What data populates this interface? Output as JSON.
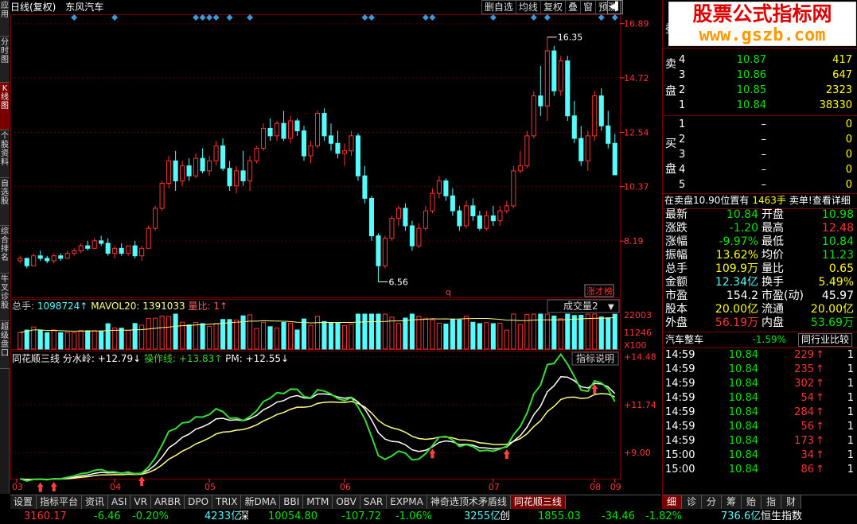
{
  "left_nav": [
    {
      "label": "应用",
      "active": false
    },
    {
      "label": "分时图",
      "active": false
    },
    {
      "label": "K线图",
      "active": true
    },
    {
      "label": "个股资料",
      "active": false
    },
    {
      "label": "自选股",
      "active": false
    },
    {
      "label": "综合排名",
      "active": false
    },
    {
      "label": "牛叉诊股",
      "active": false
    },
    {
      "label": "超级盘口",
      "active": false
    }
  ],
  "title": {
    "mode": "日线(复权)",
    "stock": "东风汽车"
  },
  "toolbar": [
    "删自选",
    "均线",
    "复权",
    "叠",
    "窗",
    "预测"
  ],
  "price_ticks": [
    "16.89",
    "14.72",
    "12.54",
    "10.37",
    "8.19"
  ],
  "max_label": "16.35",
  "min_label": "6.56",
  "q_label": "q",
  "zhangcai_label": "涨才榜",
  "volume": {
    "zongshou_label": "总手:",
    "zongshou": "1098724",
    "mavol_label": "MAVOL20:",
    "mavol": "1391033",
    "liangbi_label": "量比:",
    "liangbi": "1",
    "dropdown": "成交量2",
    "ticks": [
      "22003",
      "11246",
      "X100"
    ]
  },
  "indicator": {
    "name": "同花顺三线",
    "fsl_label": "分水岭:",
    "fsl": "+12.79",
    "czx_label": "操作线:",
    "czx": "+13.83",
    "pm_label": "PM:",
    "pm": "+12.55",
    "help": "指标说明",
    "ticks": [
      "+14.48",
      "+11.74",
      "+9.00"
    ]
  },
  "months": [
    "03",
    "04",
    "05",
    "06",
    "07",
    "08",
    "09"
  ],
  "tabs": [
    "设置",
    "指标平台",
    "资讯",
    "ASI",
    "VR",
    "ARBR",
    "DPO",
    "TRIX",
    "新DMA",
    "BBI",
    "MTM",
    "OBV",
    "SAR",
    "EXPMA",
    "神奇选顶术矛盾线",
    "同花顺三线"
  ],
  "active_tab": "同花顺三线",
  "right_tabs": [
    "细",
    "诊",
    "分",
    "筹",
    "贻",
    "指",
    "财"
  ],
  "right_active": "细",
  "watermark": {
    "line1": "股票公式指标网",
    "line2": "www.gszb.com"
  },
  "weibi_label": "委",
  "sell_label": [
    "卖",
    "盘"
  ],
  "buy_label": [
    "买",
    "盘"
  ],
  "sells": [
    {
      "n": "4",
      "p": "10.87",
      "v": "417"
    },
    {
      "n": "3",
      "p": "10.86",
      "v": "647"
    },
    {
      "n": "2",
      "p": "10.85",
      "v": "2323"
    },
    {
      "n": "1",
      "p": "10.84",
      "v": "38330"
    }
  ],
  "buys": [
    {
      "n": "1",
      "p": "–",
      "v": "0"
    },
    {
      "n": "2",
      "p": "–",
      "v": "0"
    },
    {
      "n": "3",
      "p": "–",
      "v": "0"
    },
    {
      "n": "4",
      "p": "–",
      "v": "0"
    },
    {
      "n": "5",
      "p": "–",
      "v": "0"
    }
  ],
  "notice": {
    "pre": "在卖盘10.90位置有",
    "num": "1463手",
    "post": "卖单!",
    "link": "查看详细"
  },
  "quote": [
    {
      "l1": "最新",
      "v1": "10.84",
      "c1": "green",
      "l2": "开盘",
      "v2": "10.98",
      "c2": "green"
    },
    {
      "l1": "涨跌",
      "v1": "-1.20",
      "c1": "green",
      "l2": "最高",
      "v2": "12.48",
      "c2": "red"
    },
    {
      "l1": "涨幅",
      "v1": "-9.97%",
      "c1": "green",
      "l2": "最低",
      "v2": "10.84",
      "c2": "green"
    },
    {
      "l1": "振幅",
      "v1": "13.62%",
      "c1": "yellow",
      "l2": "均价",
      "v2": "11.23",
      "c2": "green"
    },
    {
      "l1": "总手",
      "v1": "109.9万",
      "c1": "yellow",
      "l2": "量比",
      "v2": "0.65",
      "c2": "yellow"
    },
    {
      "l1": "金额",
      "v1": "12.34亿",
      "c1": "cyan",
      "l2": "换手",
      "v2": "5.49%",
      "c2": "yellow"
    },
    {
      "l1": "市盈",
      "v1": "154.2",
      "c1": "white",
      "l2": "市盈(动)",
      "v2": "45.97",
      "c2": "white"
    },
    {
      "l1": "股本",
      "v1": "20.00亿",
      "c1": "yellow",
      "l2": "流通",
      "v2": "20.00亿",
      "c2": "yellow"
    },
    {
      "l1": "外盘",
      "v1": "56.19万",
      "c1": "red",
      "l2": "内盘",
      "v2": "53.69万",
      "c2": "green"
    }
  ],
  "sector": {
    "name": "汽车整车",
    "chg": "-1.59%",
    "link": "同行业比较"
  },
  "ticks": [
    {
      "t": "14:59",
      "p": "10.84",
      "v": "229",
      "n": "1"
    },
    {
      "t": "14:59",
      "p": "10.84",
      "v": "235",
      "n": "1"
    },
    {
      "t": "14:59",
      "p": "10.84",
      "v": "302",
      "n": "1"
    },
    {
      "t": "14:59",
      "p": "10.84",
      "v": "54",
      "n": "1"
    },
    {
      "t": "14:59",
      "p": "10.84",
      "v": "284",
      "n": "1"
    },
    {
      "t": "14:59",
      "p": "10.84",
      "v": "56",
      "n": "1"
    },
    {
      "t": "14:59",
      "p": "10.84",
      "v": "173",
      "n": "1"
    },
    {
      "t": "15:00",
      "p": "10.84",
      "v": "34",
      "n": "1"
    },
    {
      "t": "15:00",
      "p": "10.84",
      "v": "86",
      "n": "1"
    }
  ],
  "status": [
    {
      "t": "3160.17",
      "c": "red"
    },
    {
      "t": "-6.46",
      "c": "green"
    },
    {
      "t": "-0.20%",
      "c": "green"
    },
    {
      "t": "4233亿",
      "c": "cyan"
    },
    {
      "t": "深",
      "c": "white"
    },
    {
      "t": "10054.80",
      "c": "green"
    },
    {
      "t": "-107.72",
      "c": "green"
    },
    {
      "t": "-1.06%",
      "c": "green"
    },
    {
      "t": "3255亿",
      "c": "cyan"
    },
    {
      "t": "创",
      "c": "white"
    },
    {
      "t": "1855.03",
      "c": "green"
    },
    {
      "t": "-34.46",
      "c": "green"
    },
    {
      "t": "-1.82%",
      "c": "green"
    },
    {
      "t": "736.6亿",
      "c": "cyan"
    },
    {
      "t": "恒生指数",
      "c": "white"
    }
  ],
  "colors": {
    "up": "#ff3232",
    "down": "#54fcfc",
    "frame": "#7a0000",
    "ma_white": "#ffffff",
    "ma_yellow": "#ffff80",
    "ma_green": "#33dd33"
  },
  "chart_data": {
    "type": "candlestick",
    "price_range": [
      6.0,
      17.2
    ],
    "candles": [
      [
        7.4,
        7.6,
        7.3,
        7.5
      ],
      [
        7.5,
        7.5,
        7.1,
        7.2
      ],
      [
        7.2,
        7.7,
        7.2,
        7.6
      ],
      [
        7.6,
        7.8,
        7.4,
        7.5
      ],
      [
        7.5,
        7.6,
        7.3,
        7.4
      ],
      [
        7.4,
        7.7,
        7.3,
        7.6
      ],
      [
        7.6,
        7.7,
        7.4,
        7.5
      ],
      [
        7.5,
        7.8,
        7.5,
        7.7
      ],
      [
        7.7,
        7.9,
        7.6,
        7.8
      ],
      [
        7.8,
        8.1,
        7.7,
        8.0
      ],
      [
        8.0,
        8.2,
        7.8,
        7.9
      ],
      [
        7.9,
        8.3,
        7.9,
        8.2
      ],
      [
        8.2,
        8.4,
        8.0,
        8.1
      ],
      [
        8.1,
        8.3,
        7.6,
        7.7
      ],
      [
        7.7,
        8.0,
        7.5,
        7.9
      ],
      [
        7.9,
        8.1,
        7.6,
        7.7
      ],
      [
        7.7,
        8.0,
        7.6,
        8.0
      ],
      [
        8.0,
        8.2,
        7.5,
        7.6
      ],
      [
        7.6,
        8.0,
        7.4,
        7.9
      ],
      [
        7.9,
        8.8,
        7.9,
        8.7
      ],
      [
        8.7,
        9.6,
        8.6,
        9.5
      ],
      [
        9.5,
        10.6,
        9.4,
        10.5
      ],
      [
        10.5,
        11.6,
        10.3,
        11.4
      ],
      [
        11.4,
        11.8,
        10.2,
        10.6
      ],
      [
        10.6,
        11.4,
        10.4,
        11.2
      ],
      [
        11.2,
        11.5,
        10.6,
        10.8
      ],
      [
        10.8,
        11.7,
        10.7,
        11.5
      ],
      [
        11.5,
        11.9,
        10.9,
        11.0
      ],
      [
        11.0,
        11.6,
        10.8,
        11.4
      ],
      [
        11.4,
        12.2,
        11.2,
        12.0
      ],
      [
        12.0,
        12.3,
        11.0,
        11.1
      ],
      [
        11.1,
        11.4,
        10.2,
        10.4
      ],
      [
        10.4,
        11.2,
        10.1,
        11.0
      ],
      [
        11.0,
        11.8,
        10.4,
        10.6
      ],
      [
        10.6,
        11.6,
        10.2,
        11.4
      ],
      [
        11.4,
        12.0,
        11.3,
        11.9
      ],
      [
        11.9,
        12.9,
        11.8,
        12.7
      ],
      [
        12.7,
        13.1,
        12.2,
        12.4
      ],
      [
        12.4,
        13.0,
        12.2,
        12.9
      ],
      [
        12.9,
        13.4,
        12.2,
        12.3
      ],
      [
        12.3,
        13.2,
        12.1,
        13.0
      ],
      [
        13.0,
        13.1,
        12.4,
        12.6
      ],
      [
        12.6,
        12.8,
        11.4,
        11.6
      ],
      [
        11.6,
        12.2,
        11.3,
        12.0
      ],
      [
        12.0,
        13.4,
        11.9,
        13.3
      ],
      [
        13.3,
        13.5,
        12.2,
        12.4
      ],
      [
        12.4,
        12.9,
        11.8,
        12.1
      ],
      [
        12.1,
        12.6,
        11.5,
        11.7
      ],
      [
        11.7,
        12.1,
        11.2,
        11.8
      ],
      [
        11.8,
        12.6,
        11.6,
        12.4
      ],
      [
        12.4,
        12.5,
        10.6,
        10.8
      ],
      [
        10.8,
        11.2,
        9.7,
        9.9
      ],
      [
        9.9,
        10.0,
        8.2,
        8.4
      ],
      [
        8.4,
        8.5,
        6.56,
        7.2
      ],
      [
        7.2,
        8.4,
        7.1,
        8.3
      ],
      [
        8.3,
        9.2,
        8.2,
        9.1
      ],
      [
        9.1,
        9.6,
        8.8,
        9.5
      ],
      [
        9.5,
        9.7,
        8.6,
        8.8
      ],
      [
        8.8,
        9.0,
        7.8,
        8.0
      ],
      [
        8.0,
        8.9,
        7.9,
        8.7
      ],
      [
        8.7,
        9.6,
        8.6,
        9.4
      ],
      [
        9.4,
        10.3,
        9.3,
        10.1
      ],
      [
        10.1,
        10.8,
        9.9,
        10.6
      ],
      [
        10.6,
        10.7,
        9.8,
        10.0
      ],
      [
        10.0,
        10.3,
        9.2,
        9.4
      ],
      [
        9.4,
        9.6,
        8.6,
        8.8
      ],
      [
        8.8,
        9.8,
        8.7,
        9.6
      ],
      [
        9.6,
        9.9,
        9.0,
        9.2
      ],
      [
        9.2,
        9.4,
        8.6,
        8.7
      ],
      [
        8.7,
        9.4,
        8.6,
        9.2
      ],
      [
        9.2,
        9.6,
        8.8,
        9.0
      ],
      [
        9.0,
        9.6,
        8.8,
        9.4
      ],
      [
        9.4,
        9.8,
        9.3,
        9.6
      ],
      [
        9.6,
        11.2,
        9.5,
        11.0
      ],
      [
        11.0,
        11.8,
        10.9,
        11.2
      ],
      [
        11.2,
        12.6,
        11.1,
        12.4
      ],
      [
        12.4,
        14.2,
        12.3,
        14.0
      ],
      [
        14.0,
        15.2,
        13.2,
        13.6
      ],
      [
        13.6,
        16.35,
        13.0,
        15.8
      ],
      [
        15.8,
        16.0,
        14.0,
        14.2
      ],
      [
        14.2,
        15.6,
        14.0,
        15.4
      ],
      [
        15.4,
        15.6,
        13.0,
        13.2
      ],
      [
        13.2,
        13.8,
        12.1,
        12.3
      ],
      [
        12.3,
        12.8,
        11.2,
        11.4
      ],
      [
        11.4,
        12.6,
        11.0,
        12.4
      ],
      [
        12.4,
        14.2,
        12.2,
        14.0
      ],
      [
        14.0,
        14.3,
        12.6,
        12.8
      ],
      [
        12.8,
        13.4,
        11.9,
        12.1
      ],
      [
        12.1,
        12.48,
        10.84,
        10.84
      ]
    ]
  }
}
